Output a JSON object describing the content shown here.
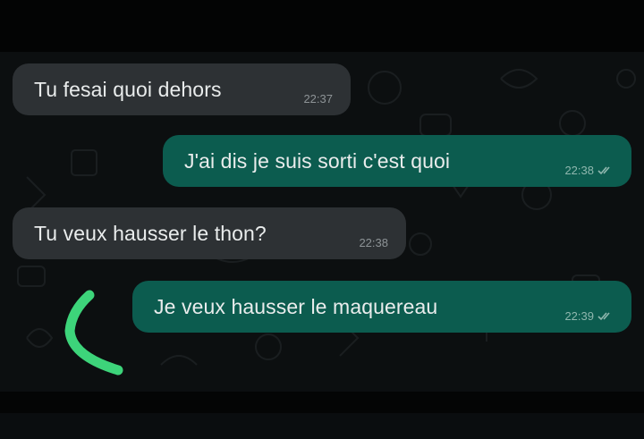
{
  "conversation": {
    "messages": [
      {
        "direction": "in",
        "text": "Tu fesai quoi dehors",
        "time": "22:37",
        "read": false
      },
      {
        "direction": "out",
        "text": "J'ai dis je suis sorti c'est quoi",
        "time": "22:38",
        "read": true
      },
      {
        "direction": "in",
        "text": "Tu veux hausser le thon?",
        "time": "22:38",
        "read": false
      },
      {
        "direction": "out",
        "text": "Je veux hausser le maquereau",
        "time": "22:39",
        "read": true
      }
    ]
  },
  "colors": {
    "incoming_bubble": "#2d3134",
    "outgoing_bubble": "#0c5c4f",
    "background": "#0c0f10",
    "annotation_stroke": "#3dd47a"
  },
  "icons": {
    "read_receipt": "double-check-icon",
    "annotation": "green-bracket-annotation"
  }
}
